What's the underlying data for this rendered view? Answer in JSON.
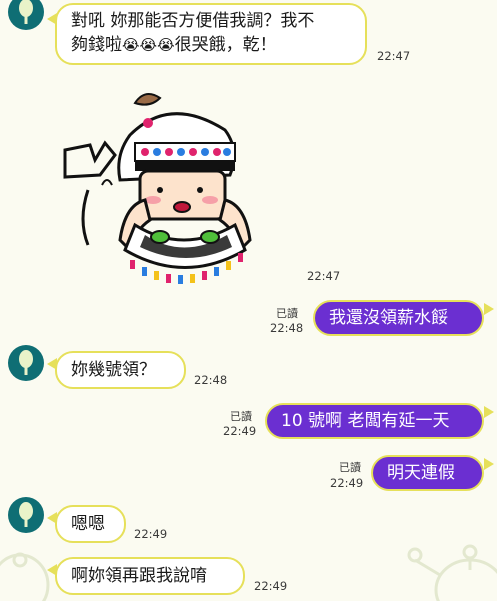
{
  "colors": {
    "background": "#fbfbf1",
    "outgoing_bubble": "#6b2fd1",
    "bubble_border": "#e6e05a",
    "avatar": "#0f6e74"
  },
  "messages": [
    {
      "id": "m1",
      "direction": "in",
      "line1": "對吼 妳那能否方便借我調？我不",
      "line2_pre": "夠錢啦",
      "emoji": "😭",
      "line2_post": "很哭餓，乾！",
      "time": "22:47"
    },
    {
      "id": "m2",
      "direction": "in",
      "type": "sticker",
      "sticker_icon": "girl-cheeks-sticker",
      "time": "22:47"
    },
    {
      "id": "m3",
      "direction": "out",
      "text": "我還沒領薪水餒",
      "read": "已讀",
      "time": "22:48"
    },
    {
      "id": "m4",
      "direction": "in",
      "text": "妳幾號領？",
      "time": "22:48"
    },
    {
      "id": "m5",
      "direction": "out",
      "text": "10 號啊 老闆有延一天",
      "read": "已讀",
      "time": "22:49"
    },
    {
      "id": "m6",
      "direction": "out",
      "text": "明天連假",
      "read": "已讀",
      "time": "22:49"
    },
    {
      "id": "m7",
      "direction": "in",
      "text": "嗯嗯",
      "time": "22:49"
    },
    {
      "id": "m8",
      "direction": "in",
      "text": "啊妳領再跟我說唷",
      "time": "22:49"
    }
  ]
}
